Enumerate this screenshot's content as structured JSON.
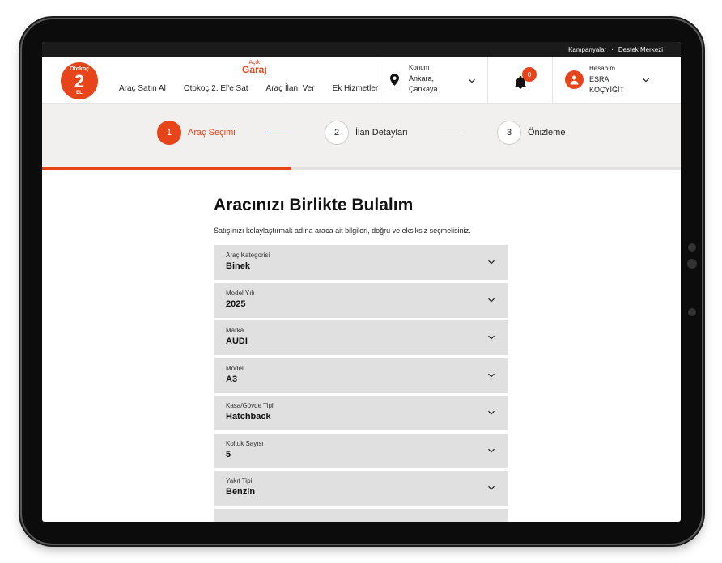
{
  "topbar": {
    "campaigns": "Kampanyalar",
    "separator": "·",
    "support": "Destek Merkezi"
  },
  "header": {
    "logo": {
      "top": "Otokoç",
      "mid": "2",
      "bottom": "EL"
    },
    "acik_garaj": {
      "top": "Açık",
      "bottom": "Garaj"
    },
    "nav": [
      "Araç Satın Al",
      "Otokoç 2. El'e Sat",
      "Araç İlanı Ver",
      "Ek Hizmetler"
    ],
    "location": {
      "label": "Konum",
      "line1": "Ankara,",
      "line2": "Çankaya"
    },
    "notifications": {
      "count": "0"
    },
    "account": {
      "label": "Hesabım",
      "line1": "ESRA",
      "line2": "KOÇYİĞİT"
    }
  },
  "stepper": {
    "steps": [
      {
        "num": "1",
        "label": "Araç Seçimi"
      },
      {
        "num": "2",
        "label": "İlan Detayları"
      },
      {
        "num": "3",
        "label": "Önizleme"
      }
    ],
    "progress": 0.39
  },
  "main": {
    "title": "Aracınızı Birlikte Bulalım",
    "subtitle": "Satışınızı kolaylaştırmak adına araca ait bilgileri, doğru ve eksiksiz seçmelisiniz.",
    "fields": [
      {
        "label": "Araç Kategorisi",
        "value": "Binek"
      },
      {
        "label": "Model Yılı",
        "value": "2025"
      },
      {
        "label": "Marka",
        "value": "AUDI"
      },
      {
        "label": "Model",
        "value": "A3"
      },
      {
        "label": "Kasa/Gövde Tipi",
        "value": "Hatchback"
      },
      {
        "label": "Koltuk Sayısı",
        "value": "5"
      },
      {
        "label": "Yakıt Tipi",
        "value": "Benzin"
      }
    ]
  },
  "colors": {
    "accent": "#e8441a",
    "field_bg": "#e0e0e0",
    "stepper_bg": "#f2f0ee"
  }
}
